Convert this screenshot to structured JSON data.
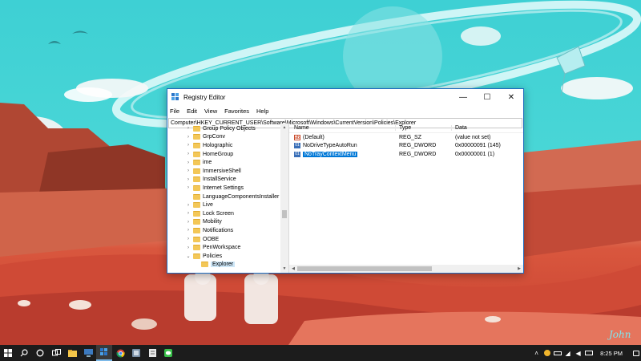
{
  "window": {
    "title": "Registry Editor",
    "minimize": "—",
    "maximize": "☐",
    "close": "✕"
  },
  "menu": [
    "File",
    "Edit",
    "View",
    "Favorites",
    "Help"
  ],
  "address": "Computer\\HKEY_CURRENT_USER\\Software\\Microsoft\\Windows\\CurrentVersion\\Policies\\Explorer",
  "tree": [
    {
      "label": "Group Policy Objects",
      "expandable": true
    },
    {
      "label": "GrpConv",
      "expandable": true
    },
    {
      "label": "Holographic",
      "expandable": true
    },
    {
      "label": "HomeGroup",
      "expandable": true
    },
    {
      "label": "ime",
      "expandable": true
    },
    {
      "label": "ImmersiveShell",
      "expandable": true
    },
    {
      "label": "InstallService",
      "expandable": true
    },
    {
      "label": "Internet Settings",
      "expandable": true
    },
    {
      "label": "LanguageComponentsInstaller",
      "expandable": false
    },
    {
      "label": "Live",
      "expandable": true
    },
    {
      "label": "Lock Screen",
      "expandable": true
    },
    {
      "label": "Mobility",
      "expandable": true
    },
    {
      "label": "Notifications",
      "expandable": true
    },
    {
      "label": "OOBE",
      "expandable": true
    },
    {
      "label": "PenWorkspace",
      "expandable": true
    },
    {
      "label": "Policies",
      "expandable": true,
      "expanded": true
    },
    {
      "label": "Explorer",
      "expandable": false,
      "sub": true,
      "selected": true
    }
  ],
  "columns": {
    "name": "Name",
    "type": "Type",
    "data": "Data"
  },
  "values": [
    {
      "name": "(Default)",
      "type": "REG_SZ",
      "data": "(value not set)",
      "icon": "string-value-icon"
    },
    {
      "name": "NoDriveTypeAutoRun",
      "type": "REG_DWORD",
      "data": "0x00000091 (145)",
      "icon": "dword-value-icon"
    },
    {
      "name": "NoTrayContextMenu",
      "type": "REG_DWORD",
      "data": "0x00000001 (1)",
      "icon": "dword-value-icon",
      "selected": true
    }
  ],
  "taskbar": {
    "time": "8:25 PM",
    "apps": [
      "start-icon",
      "search-icon",
      "cortana-icon",
      "task-view-icon",
      "file-explorer-icon",
      "network-app-icon",
      "registry-editor-icon",
      "chrome-icon",
      "settings-app-icon",
      "notes-icon",
      "line-app-icon"
    ]
  },
  "wallpaper": {
    "signature": "John"
  }
}
